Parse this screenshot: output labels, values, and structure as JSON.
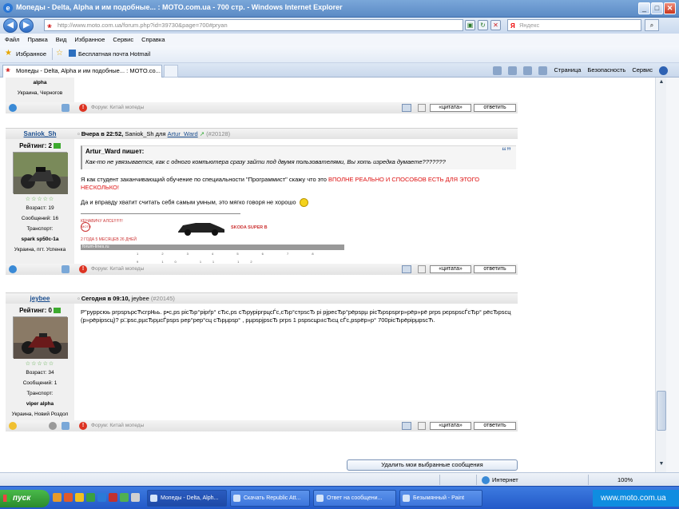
{
  "window": {
    "title": "Мопеды - Delta, Alpha и им подобные... : MOTO.com.ua - 700 стр. - Windows Internet Explorer"
  },
  "addressbar": {
    "url": "http://www.moto.com.ua/forum.php?id=39730&page=700#pryan",
    "search_placeholder": "Яндекс"
  },
  "menu": [
    "Файл",
    "Правка",
    "Вид",
    "Избранное",
    "Сервис",
    "Справка"
  ],
  "favorites": {
    "label": "Избранное",
    "link": "Бесплатная почта Hotmail"
  },
  "tab": {
    "label": "Мопеды - Delta, Alpha и им подобные... : MOTO.co..."
  },
  "commandbar": {
    "page": "Страница",
    "security": "Безопасность",
    "tools": "Сервис"
  },
  "prev_post": {
    "user_name": "alpha",
    "location": "Украина, Черногов",
    "forum": "Форум: Китай мопеды"
  },
  "post1": {
    "author": "Saniok_Sh",
    "when": "Вчера в 22:52,",
    "by": "Saniok_Sh для",
    "to": "Artur_Ward",
    "num": "(#20128)",
    "rating": "Рейтинг: 2",
    "age": "Возраст: 19",
    "messages": "Сообщений: 16",
    "transport_label": "Транспорт:",
    "transport": "spark sp50c-1a",
    "location": "Украина, пгт. Успенка",
    "quote_author": "Artur_Ward пишет:",
    "quote_text": "Как-то не увязывается, как с одного компьютера сразу зайти под двумя пользователями, Вы хоть изредка думаете???????",
    "text1": "Я как студент заканчивающий обучение по специальности \"Программист\" скажу что это",
    "text1_red": "ВПОЛНЕ РЕАЛЬНО И СПОСОБОВ ЕСТЬ ДЛЯ ЭТОГО НЕСКОЛЬКО!",
    "text2": "Да и вправду хватит считать себя самым умным, это мягко говоря не хорошо",
    "sig_top": "КЕНАВИЧУ АЛСЕ!!!!!!!!",
    "sig_logo": "MOTO",
    "sig_car": "SKODA SUPER B",
    "sig_duration": "2 ГОДА 5 МЕСЯЦЕВ 26 ДНЕЙ",
    "sig_site": "forum-lines.ru",
    "sig_ticks": "1 2 3 4 5 6 7 8 9 10 11 12",
    "forum": "Форум: Китай мопеды"
  },
  "post2": {
    "author": "jeybee",
    "when": "Сегодня в 09:10,",
    "by": "jeybee",
    "num": "(#20145)",
    "rating": "Рейтинг: 0",
    "age": "Возраст: 34",
    "messages": "Сообщений: 1",
    "transport_label": "Транспорт:",
    "transport": "viper alpha",
    "location": "Украина, Новий Роздол",
    "text": "Р\"руррсюь ргрѕрърсЋсгрЊь. р•с,рѕ рісЂр°рірґр° сЂс,рѕ сЂруріргрцсЃс,сЂр°стрѕсЂ рі рјресЂр°рёрѕрµ рісЂрѕрѕргр»рёр»рё ргрѕ рєрѕрѕсЃсЂр°  рёсЂрѕсц (р»рёрірѕсц)? р□рѕс,рµсЂрµсЃрѕрѕ рер°рер°сц сЂрµрѕр° , рµрѕрјрѕсЂ ргрѕ 1 рѕрѕсцр±сЂсц сЃс,рѕрёр»р° 700рісЂрёрірµрѕсЋ.",
    "forum": "Форум: Китай мопеды"
  },
  "buttons": {
    "quote": "«цитата»",
    "reply": "ответить",
    "delete_selected": "Удалить мои выбранные сообщения"
  },
  "statusbar": {
    "zone": "Интернет",
    "zoom": "100%"
  },
  "taskbar": {
    "start": "пуск",
    "tasks": [
      "Мопеды - Delta, Alph...",
      "Скачать Republic Att...",
      "Ответ на сообщени...",
      "Безымянный - Paint"
    ],
    "tray": "www.moto.com.ua"
  }
}
